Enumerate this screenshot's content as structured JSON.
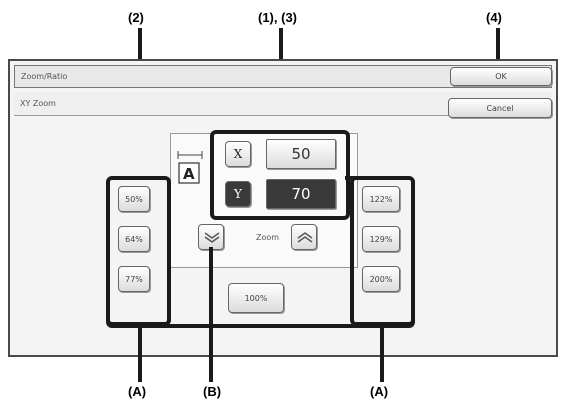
{
  "callouts": {
    "c2": "(2)",
    "c13": "(1), (3)",
    "c4": "(4)",
    "a_left": "(A)",
    "b": "(B)",
    "a_right": "(A)"
  },
  "screen": {
    "title": "Zoom/Ratio",
    "ok_label": "OK",
    "subtitle": "XY Zoom",
    "cancel_label": "Cancel",
    "x_axis_label": "X",
    "y_axis_label": "Y",
    "x_value": "50",
    "y_value": "70",
    "reduce_buttons": [
      "50%",
      "64%",
      "77%"
    ],
    "enlarge_buttons": [
      "122%",
      "129%",
      "200%"
    ],
    "zoom_label": "Zoom",
    "reset_label": "100%",
    "doc_letter": "A"
  }
}
